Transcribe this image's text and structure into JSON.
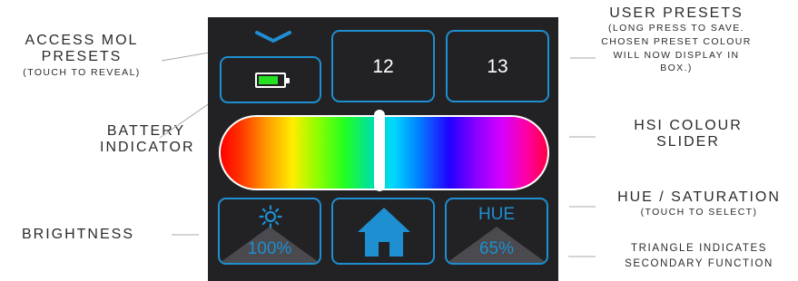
{
  "labels": {
    "access_main_1": "ACCESS MOL",
    "access_main_2": "PRESETS",
    "access_sub": "(TOUCH TO REVEAL)",
    "battery_1": "BATTERY",
    "battery_2": "INDICATOR",
    "brightness": "BRIGHTNESS",
    "user_main": "USER PRESETS",
    "user_sub_1": "(LONG PRESS TO SAVE.",
    "user_sub_2": "CHOSEN PRESET COLOUR",
    "user_sub_3": "WILL NOW DISPLAY IN",
    "user_sub_4": "BOX.)",
    "hsi_1": "HSI COLOUR",
    "hsi_2": "SLIDER",
    "hue_main": "HUE / SATURATION",
    "hue_sub": "(TOUCH TO SELECT)",
    "triangle_1": "TRIANGLE INDICATES",
    "triangle_2": "SECONDARY FUNCTION"
  },
  "device": {
    "presets": [
      "12",
      "13"
    ],
    "battery_level": 0.8,
    "slider_position": 0.485,
    "brightness_value": "100%",
    "hue_label": "HUE",
    "hue_value": "65%",
    "icons": [
      "chevron-down-icon",
      "battery-icon",
      "sun-icon",
      "home-icon"
    ]
  },
  "colors": {
    "panel": "#222225",
    "accent": "#1e8fd0",
    "battery_fill": "#27e021",
    "triangle": "#4a4a4f"
  }
}
